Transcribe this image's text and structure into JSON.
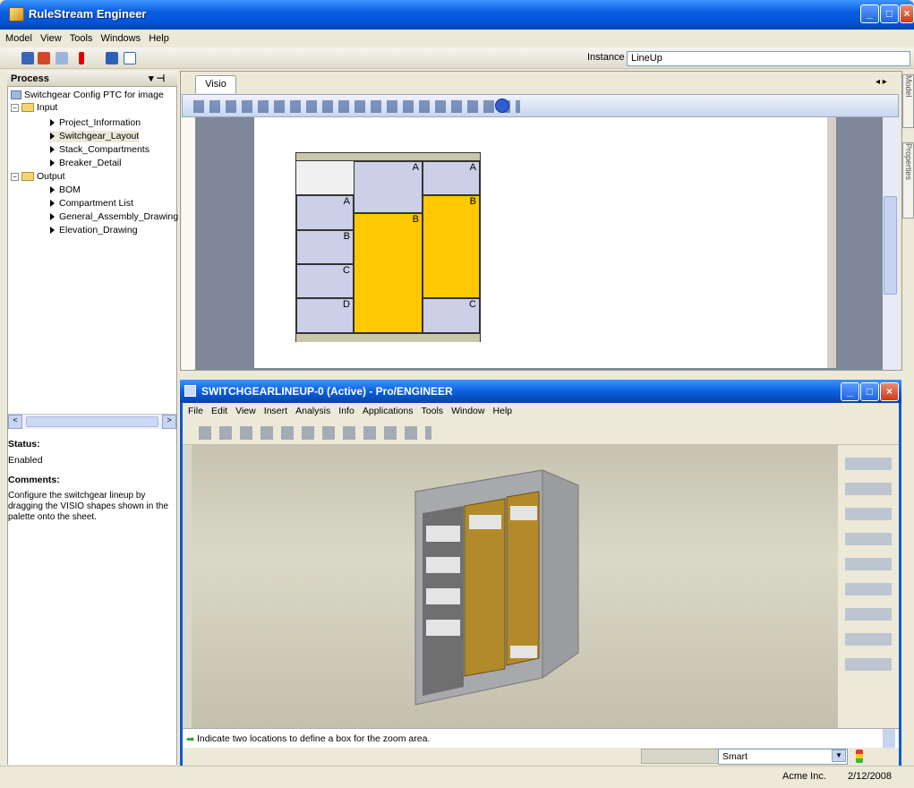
{
  "app": {
    "title": "RuleStream Engineer"
  },
  "menu": [
    "Model",
    "View",
    "Tools",
    "Windows",
    "Help"
  ],
  "instance": {
    "label": "Instance",
    "value": "LineUp"
  },
  "process": {
    "title": "Process",
    "root": "Switchgear Config PTC for image",
    "input_label": "Input",
    "inputs": [
      "Project_Information",
      "Switchgear_Layout",
      "Stack_Compartments",
      "Breaker_Detail"
    ],
    "output_label": "Output",
    "outputs": [
      "BOM",
      "Compartment List",
      "General_Assembly_Drawing",
      "Elevation_Drawing"
    ]
  },
  "status": {
    "label": "Status:",
    "value": "Enabled",
    "comments_label": "Comments:",
    "comments": "Configure the switchgear lineup by dragging the VISIO shapes shown in the palette onto the sheet."
  },
  "tabs": {
    "visio": "Visio"
  },
  "side_tabs": [
    "Model",
    "Properties"
  ],
  "layout_cells": {
    "col1": [
      "A",
      "B",
      "C",
      "D"
    ],
    "col2": [
      "A",
      "B"
    ],
    "col3": [
      "A",
      "B",
      "C"
    ]
  },
  "proe": {
    "title": "SWITCHGEARLINEUP-0 (Active) - Pro/ENGINEER",
    "menu": [
      "File",
      "Edit",
      "View",
      "Insert",
      "Analysis",
      "Info",
      "Applications",
      "Tools",
      "Window",
      "Help"
    ],
    "message": "Indicate two locations to define a box for the zoom area.",
    "filter": "Smart"
  },
  "footer": {
    "company": "Acme Inc.",
    "date": "2/12/2008"
  }
}
